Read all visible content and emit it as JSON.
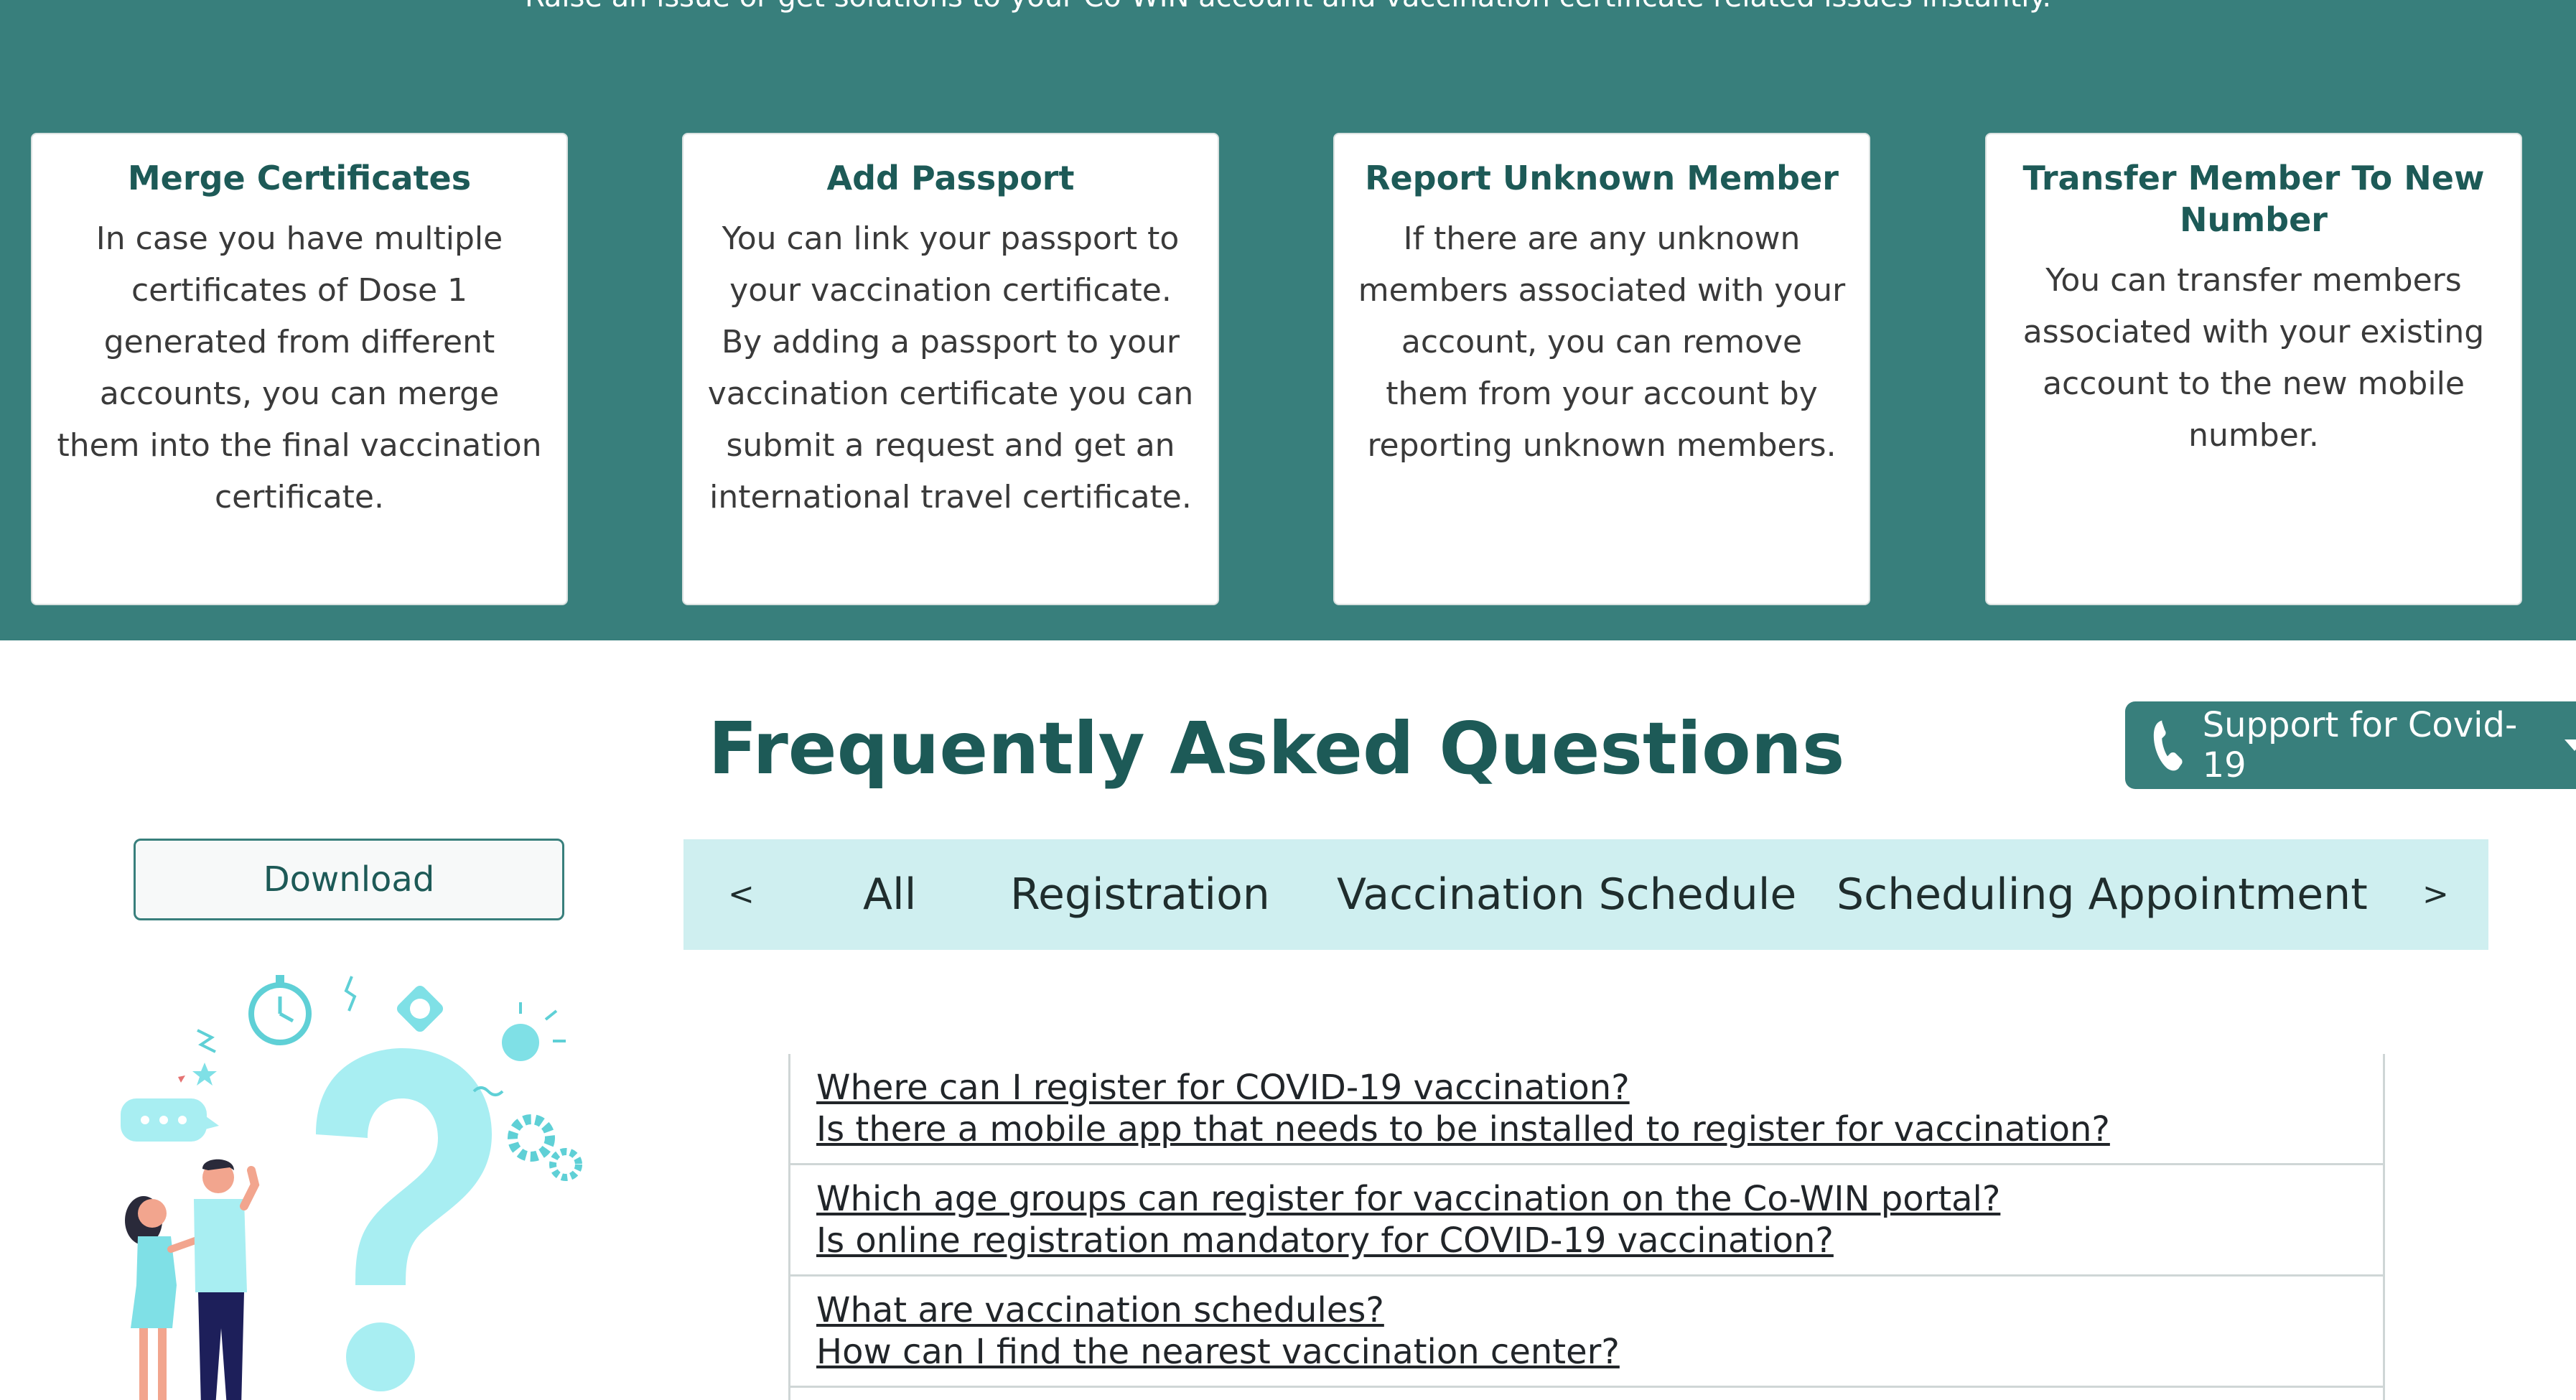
{
  "band": {
    "intro": "Raise an issue or get solutions to your Co-WIN account and vaccination certificate related issues instantly."
  },
  "cards": [
    {
      "title": "Merge Certificates",
      "text": "In case you have multiple certificates of Dose 1 generated from different accounts, you can merge them into the final vaccination certificate."
    },
    {
      "title": "Add Passport",
      "text": "You can link your passport to your vaccination certificate. By adding a passport to your vaccination certificate you can submit a request and get an international travel certificate."
    },
    {
      "title": "Report Unknown Member",
      "text": "If there are any unknown members associated with your account, you can remove them from your account by reporting unknown members."
    },
    {
      "title": "Transfer Member To New Number",
      "text": "You can transfer members associated with your existing account to the new mobile number."
    }
  ],
  "faq": {
    "title": "Frequently Asked Questions",
    "download_label": "Download",
    "tabs": {
      "prev": "<",
      "next": ">",
      "items": [
        "All",
        "Registration",
        "Vaccination Schedule",
        "Scheduling Appointment"
      ]
    },
    "questions": [
      [
        "Where can I register for COVID-19 vaccination?",
        "Is there a mobile app that needs to be installed to register for vaccination?"
      ],
      [
        "Which age groups can register for vaccination on the Co-WIN portal?",
        "Is online registration mandatory for COVID-19 vaccination?"
      ],
      [
        "What are vaccination schedules?",
        "How can I find the nearest vaccination center?"
      ]
    ]
  },
  "support": {
    "label": "Support for Covid-19",
    "icon": "phone-icon"
  },
  "colors": {
    "teal": "#387f7c",
    "teal_dark": "#1d5a57",
    "tab_bg": "#cfeff0",
    "illustration": "#a8eef2"
  }
}
